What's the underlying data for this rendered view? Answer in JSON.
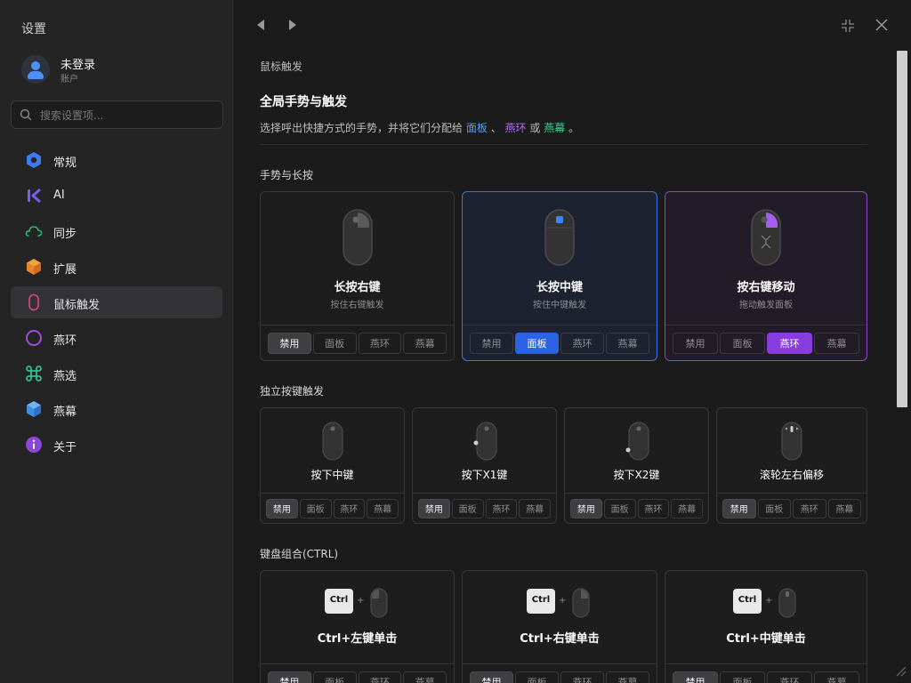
{
  "sidebar": {
    "title": "设置",
    "user": {
      "name": "未登录",
      "sub": "账户"
    },
    "search_placeholder": "搜索设置项...",
    "items": [
      {
        "label": "常规",
        "icon": "hexagon-settings-icon"
      },
      {
        "label": "AI",
        "icon": "ai-logo-icon"
      },
      {
        "label": "同步",
        "icon": "cloud-icon"
      },
      {
        "label": "扩展",
        "icon": "cube-icon"
      },
      {
        "label": "鼠标触发",
        "icon": "mouse-outline-icon"
      },
      {
        "label": "燕环",
        "icon": "ring-icon"
      },
      {
        "label": "燕选",
        "icon": "command-icon"
      },
      {
        "label": "燕幕",
        "icon": "box-icon"
      },
      {
        "label": "关于",
        "icon": "info-icon"
      }
    ],
    "active_index": 4
  },
  "colors": {
    "blue": "#2b63e4",
    "purple": "#8a3be0",
    "green": "#3ccf8c"
  },
  "main": {
    "breadcrumb": "鼠标触发",
    "heading": "全局手势与触发",
    "desc_prefix": "选择呼出快捷方式的手势，并将它们分配给",
    "link_panel": "面板",
    "sep1": "、",
    "link_ring": "燕环",
    "sep2": "或",
    "link_screen": "燕幕",
    "desc_end": "。",
    "sections": {
      "gesture": "手势与长按",
      "standalone": "独立按键触发",
      "keyboard": "键盘组合(CTRL)"
    },
    "options": [
      "禁用",
      "面板",
      "燕环",
      "燕幕"
    ],
    "gesture_cards": [
      {
        "title": "长按右键",
        "sub": "按住右键触发",
        "selected": 0
      },
      {
        "title": "长按中键",
        "sub": "按住中键触发",
        "selected": 1
      },
      {
        "title": "按右键移动",
        "sub": "拖动触发面板",
        "selected": 2
      }
    ],
    "standalone_cards": [
      {
        "title": "按下中键",
        "selected": 0
      },
      {
        "title": "按下X1键",
        "selected": 0
      },
      {
        "title": "按下X2键",
        "selected": 0
      },
      {
        "title": "滚轮左右偏移",
        "selected": 0
      }
    ],
    "keyboard_cards": [
      {
        "title": "Ctrl+左键单击",
        "key": "Ctrl",
        "selected": 0
      },
      {
        "title": "Ctrl+右键单击",
        "key": "Ctrl",
        "selected": 0
      },
      {
        "title": "Ctrl+中键单击",
        "key": "Ctrl",
        "selected": 0
      }
    ]
  }
}
